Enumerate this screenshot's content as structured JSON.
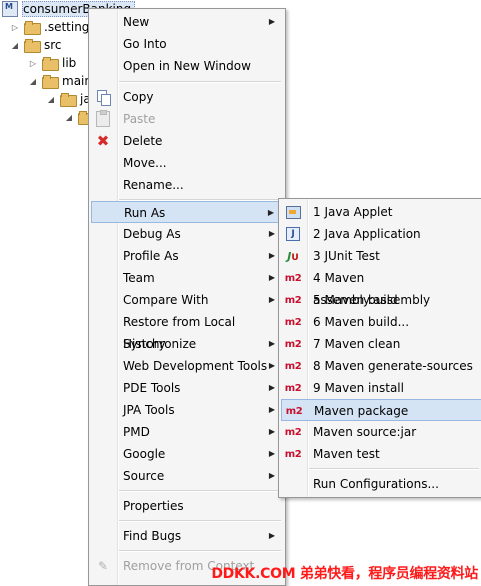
{
  "tree": {
    "items": [
      {
        "label": "consumerBanking",
        "kind": "project",
        "twisty": ""
      },
      {
        "label": ".settings",
        "kind": "folder",
        "twisty": "▷"
      },
      {
        "label": "src",
        "kind": "folder",
        "twisty": "◢"
      },
      {
        "label": "lib",
        "kind": "folder",
        "twisty": "▷"
      },
      {
        "label": "main",
        "kind": "folder",
        "twisty": "◢"
      },
      {
        "label": "ja",
        "kind": "folder",
        "twisty": "◢"
      },
      {
        "label": "",
        "kind": "folder",
        "twisty": "◢"
      }
    ]
  },
  "context_menu": {
    "items": [
      {
        "label": "New",
        "submenu": true,
        "icon": ""
      },
      {
        "label": "Go Into",
        "submenu": false,
        "icon": ""
      },
      {
        "label": "Open in New Window",
        "submenu": false,
        "icon": ""
      },
      {
        "label": "Copy",
        "submenu": false,
        "icon": "copy-icon"
      },
      {
        "label": "Paste",
        "submenu": false,
        "icon": "paste-icon",
        "disabled": true
      },
      {
        "label": "Delete",
        "submenu": false,
        "icon": "delete-icon"
      },
      {
        "label": "Move...",
        "submenu": false,
        "icon": ""
      },
      {
        "label": "Rename...",
        "submenu": false,
        "icon": ""
      },
      {
        "label": "Run As",
        "submenu": true,
        "icon": "",
        "highlighted": true
      },
      {
        "label": "Debug As",
        "submenu": true,
        "icon": ""
      },
      {
        "label": "Profile As",
        "submenu": true,
        "icon": ""
      },
      {
        "label": "Team",
        "submenu": true,
        "icon": ""
      },
      {
        "label": "Compare With",
        "submenu": true,
        "icon": ""
      },
      {
        "label": "Restore from Local History",
        "submenu": false,
        "icon": ""
      },
      {
        "label": "Synchronize",
        "submenu": true,
        "icon": ""
      },
      {
        "label": "Web Development Tools",
        "submenu": true,
        "icon": ""
      },
      {
        "label": "PDE Tools",
        "submenu": true,
        "icon": ""
      },
      {
        "label": "JPA Tools",
        "submenu": true,
        "icon": ""
      },
      {
        "label": "PMD",
        "submenu": true,
        "icon": ""
      },
      {
        "label": "Google",
        "submenu": true,
        "icon": ""
      },
      {
        "label": "Source",
        "submenu": true,
        "icon": ""
      },
      {
        "label": "Properties",
        "submenu": false,
        "icon": ""
      },
      {
        "label": "Find Bugs",
        "submenu": true,
        "icon": ""
      },
      {
        "label": "Remove from Context",
        "submenu": false,
        "icon": "remove-icon",
        "disabled": true
      }
    ]
  },
  "run_as_submenu": {
    "items": [
      {
        "label": "1 Java Applet",
        "icon": "java-applet-icon"
      },
      {
        "label": "2 Java Application",
        "icon": "java-application-icon"
      },
      {
        "label": "3 JUnit Test",
        "icon": "junit-icon"
      },
      {
        "label": "4 Maven assembly:assembly",
        "icon": "maven-m2-icon"
      },
      {
        "label": "5 Maven build",
        "icon": "maven-m2-icon"
      },
      {
        "label": "6 Maven build...",
        "icon": "maven-m2-icon"
      },
      {
        "label": "7 Maven clean",
        "icon": "maven-m2-icon"
      },
      {
        "label": "8 Maven generate-sources",
        "icon": "maven-m2-icon"
      },
      {
        "label": "9 Maven install",
        "icon": "maven-m2-icon"
      },
      {
        "label": "Maven package",
        "icon": "maven-m2-icon",
        "highlighted": true
      },
      {
        "label": "Maven source:jar",
        "icon": "maven-m2-icon"
      },
      {
        "label": "Maven test",
        "icon": "maven-m2-icon"
      },
      {
        "label": "Run Configurations...",
        "icon": ""
      }
    ],
    "m2_text": "m2",
    "junit_text": "J",
    "junit_sub": "U",
    "japp_text": "J"
  },
  "watermark": "DDKK.COM 弟弟快看，程序员编程资料站",
  "colors": {
    "menu_bg": "#f5f5f5",
    "highlight": "#d5e4f5",
    "maven_red": "#c8102e",
    "watermark_red": "#ff1a1a"
  }
}
